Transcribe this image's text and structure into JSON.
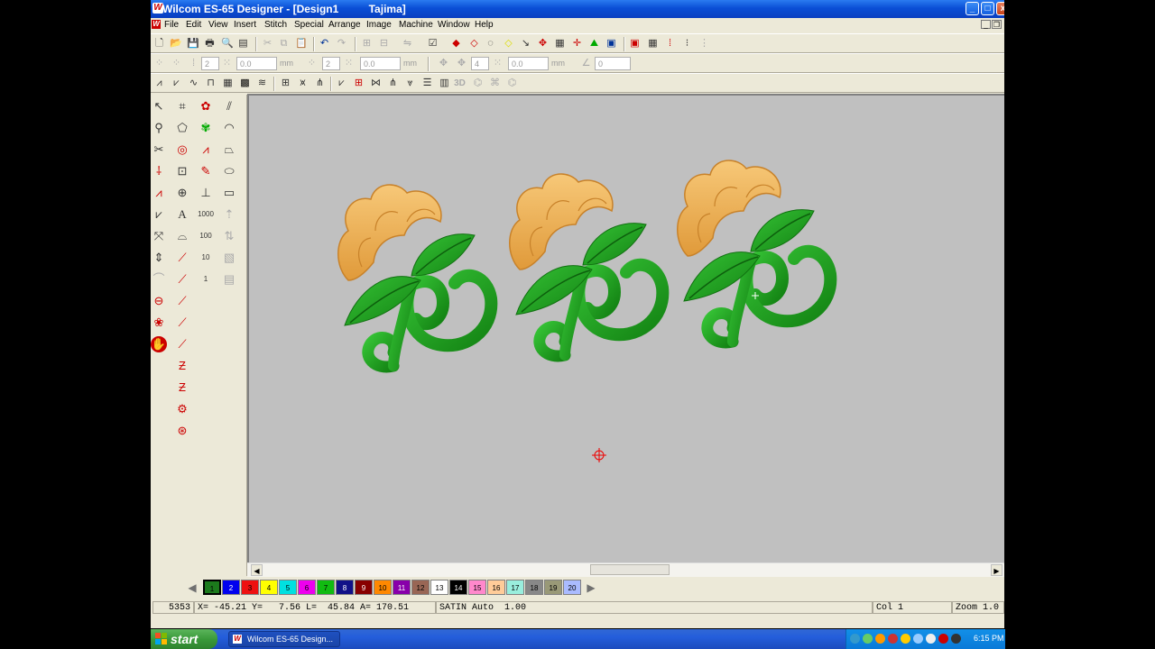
{
  "window": {
    "title": "Wilcom ES-65 Designer - [Design1          Tajima]",
    "minimize": "_",
    "maximize": "□",
    "close": "x"
  },
  "menu": [
    "File",
    "Edit",
    "View",
    "Insert",
    "Stitch",
    "Special",
    "Arrange",
    "Image",
    "Machine",
    "Window",
    "Help"
  ],
  "mdi": {
    "minimize": "_",
    "restore": "❐"
  },
  "toolbar2": {
    "fields": [
      {
        "value": "2",
        "unit": ""
      },
      {
        "value": "0.0",
        "unit": "mm"
      },
      {
        "value": "2",
        "unit": ""
      },
      {
        "value": "0.0",
        "unit": "mm"
      },
      {
        "value": "4",
        "unit": ""
      },
      {
        "value": "0.0",
        "unit": "mm"
      },
      {
        "value": "0",
        "unit": ""
      }
    ]
  },
  "toolbar3": {
    "label_3d": "3D"
  },
  "left_toolbar": {
    "labels": [
      "1000",
      "100",
      "10",
      "1"
    ]
  },
  "palette": {
    "colors": [
      {
        "label": "1",
        "color": "#1c7a1c"
      },
      {
        "label": "2",
        "color": "#0000ee"
      },
      {
        "label": "3",
        "color": "#ee1111"
      },
      {
        "label": "4",
        "color": "#ffff00"
      },
      {
        "label": "5",
        "color": "#00e0e0"
      },
      {
        "label": "6",
        "color": "#ee00ee"
      },
      {
        "label": "7",
        "color": "#11bb11"
      },
      {
        "label": "8",
        "color": "#111188"
      },
      {
        "label": "9",
        "color": "#880000"
      },
      {
        "label": "10",
        "color": "#ff8800"
      },
      {
        "label": "11",
        "color": "#8800aa"
      },
      {
        "label": "12",
        "color": "#996655"
      },
      {
        "label": "13",
        "color": "#ffffff"
      },
      {
        "label": "14",
        "color": "#000000"
      },
      {
        "label": "15",
        "color": "#ff88cc"
      },
      {
        "label": "16",
        "color": "#ffcc99"
      },
      {
        "label": "17",
        "color": "#99eedd"
      },
      {
        "label": "18",
        "color": "#888888"
      },
      {
        "label": "19",
        "color": "#999977"
      },
      {
        "label": "20",
        "color": "#aabbff"
      }
    ],
    "selected": "1"
  },
  "status": {
    "stitches": "5353",
    "coords": "X= -45.21 Y=   7.56 L=  45.84 A= 170.51",
    "stitch_type": "SATIN Auto  1.00",
    "col": "Col 1",
    "zoom": "Zoom 1.0"
  },
  "taskbar": {
    "start_label": "start",
    "item_label": "Wilcom ES-65 Design...",
    "clock": "6:15 PM"
  },
  "colors": {
    "canvas": "#c0c0c0",
    "leaf_green": "#1e9a1e",
    "petal_orange": "#f0b050",
    "title_blue": "#0a4fd6"
  }
}
